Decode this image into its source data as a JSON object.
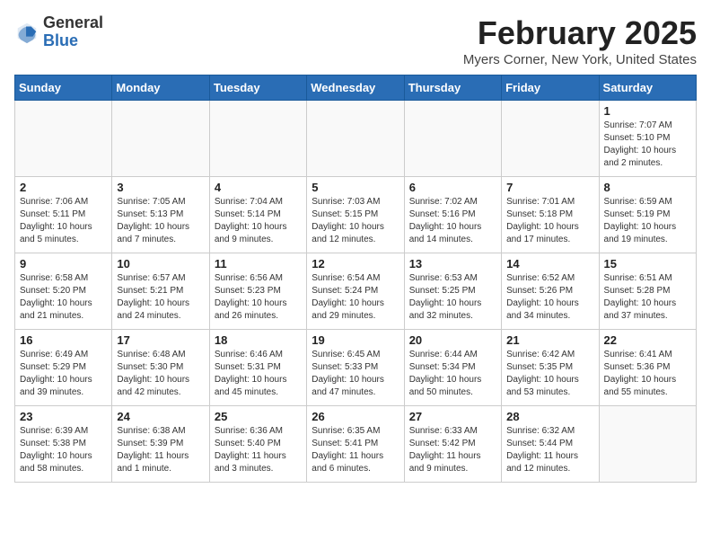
{
  "header": {
    "logo_general": "General",
    "logo_blue": "Blue",
    "month_year": "February 2025",
    "location": "Myers Corner, New York, United States"
  },
  "days_of_week": [
    "Sunday",
    "Monday",
    "Tuesday",
    "Wednesday",
    "Thursday",
    "Friday",
    "Saturday"
  ],
  "weeks": [
    [
      {
        "day": "",
        "info": ""
      },
      {
        "day": "",
        "info": ""
      },
      {
        "day": "",
        "info": ""
      },
      {
        "day": "",
        "info": ""
      },
      {
        "day": "",
        "info": ""
      },
      {
        "day": "",
        "info": ""
      },
      {
        "day": "1",
        "info": "Sunrise: 7:07 AM\nSunset: 5:10 PM\nDaylight: 10 hours and 2 minutes."
      }
    ],
    [
      {
        "day": "2",
        "info": "Sunrise: 7:06 AM\nSunset: 5:11 PM\nDaylight: 10 hours and 5 minutes."
      },
      {
        "day": "3",
        "info": "Sunrise: 7:05 AM\nSunset: 5:13 PM\nDaylight: 10 hours and 7 minutes."
      },
      {
        "day": "4",
        "info": "Sunrise: 7:04 AM\nSunset: 5:14 PM\nDaylight: 10 hours and 9 minutes."
      },
      {
        "day": "5",
        "info": "Sunrise: 7:03 AM\nSunset: 5:15 PM\nDaylight: 10 hours and 12 minutes."
      },
      {
        "day": "6",
        "info": "Sunrise: 7:02 AM\nSunset: 5:16 PM\nDaylight: 10 hours and 14 minutes."
      },
      {
        "day": "7",
        "info": "Sunrise: 7:01 AM\nSunset: 5:18 PM\nDaylight: 10 hours and 17 minutes."
      },
      {
        "day": "8",
        "info": "Sunrise: 6:59 AM\nSunset: 5:19 PM\nDaylight: 10 hours and 19 minutes."
      }
    ],
    [
      {
        "day": "9",
        "info": "Sunrise: 6:58 AM\nSunset: 5:20 PM\nDaylight: 10 hours and 21 minutes."
      },
      {
        "day": "10",
        "info": "Sunrise: 6:57 AM\nSunset: 5:21 PM\nDaylight: 10 hours and 24 minutes."
      },
      {
        "day": "11",
        "info": "Sunrise: 6:56 AM\nSunset: 5:23 PM\nDaylight: 10 hours and 26 minutes."
      },
      {
        "day": "12",
        "info": "Sunrise: 6:54 AM\nSunset: 5:24 PM\nDaylight: 10 hours and 29 minutes."
      },
      {
        "day": "13",
        "info": "Sunrise: 6:53 AM\nSunset: 5:25 PM\nDaylight: 10 hours and 32 minutes."
      },
      {
        "day": "14",
        "info": "Sunrise: 6:52 AM\nSunset: 5:26 PM\nDaylight: 10 hours and 34 minutes."
      },
      {
        "day": "15",
        "info": "Sunrise: 6:51 AM\nSunset: 5:28 PM\nDaylight: 10 hours and 37 minutes."
      }
    ],
    [
      {
        "day": "16",
        "info": "Sunrise: 6:49 AM\nSunset: 5:29 PM\nDaylight: 10 hours and 39 minutes."
      },
      {
        "day": "17",
        "info": "Sunrise: 6:48 AM\nSunset: 5:30 PM\nDaylight: 10 hours and 42 minutes."
      },
      {
        "day": "18",
        "info": "Sunrise: 6:46 AM\nSunset: 5:31 PM\nDaylight: 10 hours and 45 minutes."
      },
      {
        "day": "19",
        "info": "Sunrise: 6:45 AM\nSunset: 5:33 PM\nDaylight: 10 hours and 47 minutes."
      },
      {
        "day": "20",
        "info": "Sunrise: 6:44 AM\nSunset: 5:34 PM\nDaylight: 10 hours and 50 minutes."
      },
      {
        "day": "21",
        "info": "Sunrise: 6:42 AM\nSunset: 5:35 PM\nDaylight: 10 hours and 53 minutes."
      },
      {
        "day": "22",
        "info": "Sunrise: 6:41 AM\nSunset: 5:36 PM\nDaylight: 10 hours and 55 minutes."
      }
    ],
    [
      {
        "day": "23",
        "info": "Sunrise: 6:39 AM\nSunset: 5:38 PM\nDaylight: 10 hours and 58 minutes."
      },
      {
        "day": "24",
        "info": "Sunrise: 6:38 AM\nSunset: 5:39 PM\nDaylight: 11 hours and 1 minute."
      },
      {
        "day": "25",
        "info": "Sunrise: 6:36 AM\nSunset: 5:40 PM\nDaylight: 11 hours and 3 minutes."
      },
      {
        "day": "26",
        "info": "Sunrise: 6:35 AM\nSunset: 5:41 PM\nDaylight: 11 hours and 6 minutes."
      },
      {
        "day": "27",
        "info": "Sunrise: 6:33 AM\nSunset: 5:42 PM\nDaylight: 11 hours and 9 minutes."
      },
      {
        "day": "28",
        "info": "Sunrise: 6:32 AM\nSunset: 5:44 PM\nDaylight: 11 hours and 12 minutes."
      },
      {
        "day": "",
        "info": ""
      }
    ]
  ]
}
